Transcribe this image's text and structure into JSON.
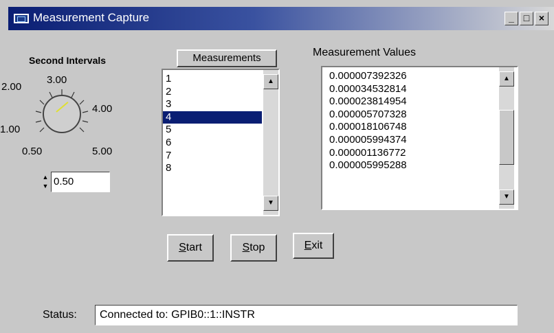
{
  "window": {
    "title": "Measurement Capture",
    "buttons": {
      "minimize": "_",
      "maximize": "□",
      "close": "×"
    }
  },
  "dial": {
    "label": "Second Intervals",
    "ticks": [
      "2.00",
      "3.00",
      "4.00",
      "1.00",
      "0.50",
      "5.00"
    ],
    "value": "0.50"
  },
  "measurements": {
    "header": "Measurements",
    "items": [
      "1",
      "2",
      "3",
      "4",
      "5",
      "6",
      "7",
      "8"
    ],
    "selected": "4"
  },
  "values": {
    "header": "Measurement Values",
    "items": [
      "0.000007392326",
      "0.000034532814",
      "0.000023814954",
      "0.000005707328",
      "0.000018106748",
      "0.000005994374",
      "0.000001136772",
      "0.000005995288"
    ]
  },
  "actions": {
    "start": {
      "hot": "S",
      "rest": "tart"
    },
    "stop": {
      "hot": "S",
      "rest": "top"
    },
    "exit": {
      "hot": "E",
      "rest": "xit"
    }
  },
  "status": {
    "label": "Status:",
    "value": "Connected to: GPIB0::1::INSTR"
  },
  "icons": {
    "scroll_up": "up-arrow-icon",
    "scroll_down": "down-arrow-icon"
  }
}
